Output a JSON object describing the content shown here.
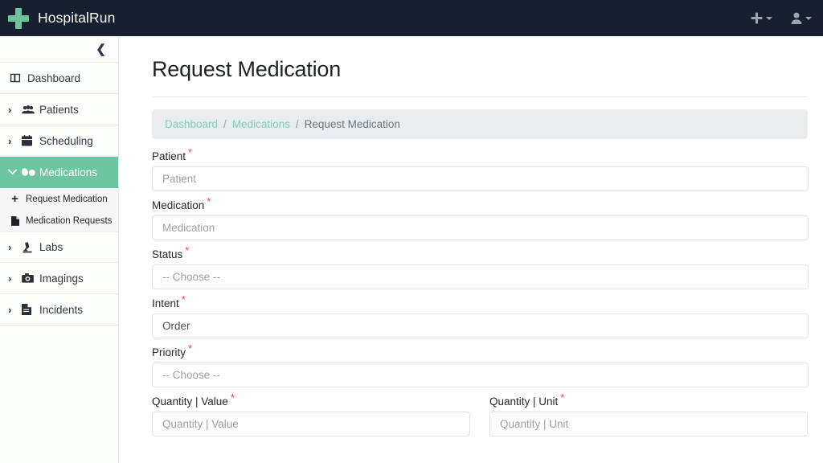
{
  "navbar": {
    "brand": "HospitalRun",
    "logo_icon": "medical-cross-icon",
    "accent_color": "#6dc49f",
    "background_color": "#16202f",
    "add_button": {
      "icon": "plus-icon",
      "caret": "chevron-down-icon"
    },
    "user_button": {
      "icon": "user-icon",
      "caret": "chevron-down-icon"
    }
  },
  "sidebar": {
    "collapse_icon": "chevron-left-icon",
    "active_color": "#6dc4a0",
    "items": [
      {
        "label": "Dashboard",
        "icon": "dashboard-columns-icon",
        "arrow": "",
        "active": false
      },
      {
        "label": "Patients",
        "icon": "users-icon",
        "arrow": "›",
        "active": false
      },
      {
        "label": "Scheduling",
        "icon": "calendar-icon",
        "arrow": "›",
        "active": false
      },
      {
        "label": "Medications",
        "icon": "pills-icon",
        "arrow": "⌄",
        "active": true
      },
      {
        "label": "Labs",
        "icon": "microscope-icon",
        "arrow": "›",
        "active": false
      },
      {
        "label": "Imagings",
        "icon": "camera-icon",
        "arrow": "›",
        "active": false
      },
      {
        "label": "Incidents",
        "icon": "file-lines-icon",
        "arrow": "›",
        "active": false
      }
    ],
    "subitems": [
      {
        "label": "Request Medication",
        "icon": "plus-icon"
      },
      {
        "label": "Medication Requests",
        "icon": "file-icon"
      }
    ]
  },
  "main": {
    "page_title": "Request Medication",
    "breadcrumb": {
      "items": [
        {
          "label": "Dashboard",
          "link": true
        },
        {
          "label": "Medications",
          "link": true
        },
        {
          "label": "Request Medication",
          "link": false
        }
      ],
      "separator": "/"
    },
    "form": {
      "fields": [
        {
          "label": "Patient",
          "required": true,
          "placeholder": "Patient",
          "value": "",
          "type": "text"
        },
        {
          "label": "Medication",
          "required": true,
          "placeholder": "Medication",
          "value": "",
          "type": "text"
        },
        {
          "label": "Status",
          "required": true,
          "placeholder": "-- Choose --",
          "value": "",
          "type": "select"
        },
        {
          "label": "Intent",
          "required": true,
          "placeholder": "-- Choose --",
          "value": "Order",
          "type": "select"
        },
        {
          "label": "Priority",
          "required": true,
          "placeholder": "-- Choose --",
          "value": "",
          "type": "select"
        }
      ],
      "quantity_row": [
        {
          "label": "Quantity | Value",
          "required": true,
          "placeholder": "Quantity | Value",
          "value": "",
          "type": "text"
        },
        {
          "label": "Quantity | Unit",
          "required": true,
          "placeholder": "Quantity | Unit",
          "value": "",
          "type": "text"
        }
      ],
      "required_marker": "*",
      "required_color": "#e8473f"
    }
  }
}
